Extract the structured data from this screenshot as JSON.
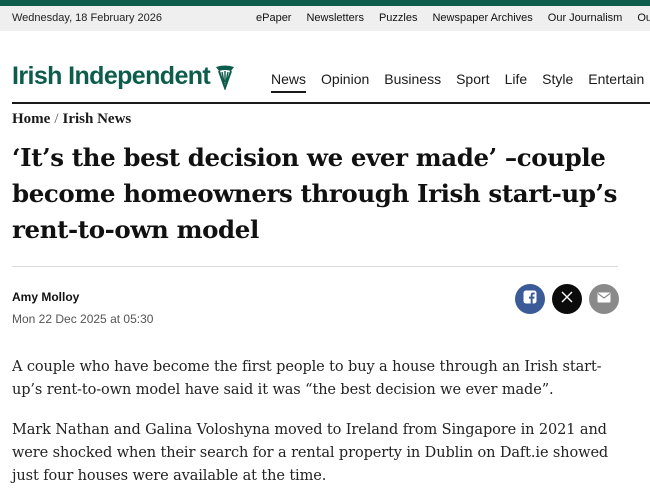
{
  "utility": {
    "date": "Wednesday, 18 February 2026",
    "links": [
      "ePaper",
      "Newsletters",
      "Puzzles",
      "Newspaper Archives",
      "Our Journalism",
      "Our S"
    ]
  },
  "masthead": {
    "logo": "Irish Independent",
    "nav": [
      "News",
      "Opinion",
      "Business",
      "Sport",
      "Life",
      "Style",
      "Entertain"
    ]
  },
  "breadcrumb": {
    "home": "Home",
    "separator": "/",
    "section": "Irish News"
  },
  "article": {
    "headline": "‘It’s the best decision we ever made’ –couple become homeowners through Irish start-up’s rent-to-own model",
    "author": "Amy Molloy",
    "date": "Mon 22 Dec 2025 at 05:30",
    "paragraphs": [
      "A couple who have become the first people to buy a house through an Irish start-up’s rent-to-own model have said it was “the best decision we ever made”.",
      "Mark Nathan and Galina Voloshyna moved to Ireland from Singapore in 2021 and were shocked when their search for a rental property in Dublin on Daft.ie showed just four houses were available at the time."
    ]
  },
  "share_icons": [
    "facebook-icon",
    "x-icon",
    "mail-icon"
  ],
  "colors": {
    "brand": "#0d5c4c",
    "facebook": "#3a5a98",
    "x": "#0b0b0b",
    "mail": "#8a8a8a"
  }
}
